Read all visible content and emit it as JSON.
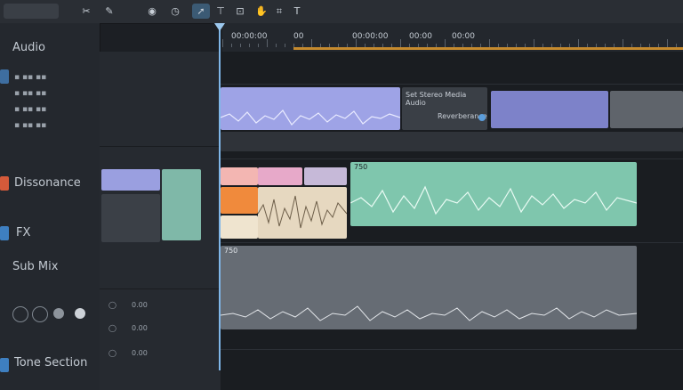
{
  "toolbar": {
    "tools": [
      "select-tool-icon",
      "razor-tool-icon",
      "slip-tool-icon",
      "text-tool-icon",
      "crop-tool-icon",
      "hand-tool-icon"
    ]
  },
  "ruler": {
    "timecodes": [
      "00:00:00",
      "00",
      "00:00:00",
      "00:00",
      "00:00"
    ]
  },
  "left_panel": {
    "labels": [
      "Audio",
      "Dissonance",
      "FX",
      "Sub Mix",
      "Tone Section"
    ]
  },
  "track_headers": {
    "values": [
      "0.00",
      "0.00",
      "0.00"
    ]
  },
  "timeline": {
    "clips": {
      "c1": "Set Stereo Media Audio",
      "c2": "Reverberance",
      "c3": "750",
      "c4": "750"
    }
  },
  "colors": {
    "accent_playhead": "#7fb6e8",
    "clip_purple": "#9a9fe0",
    "clip_teal": "#7fc6ad",
    "clip_orange": "#f08a3c",
    "clip_pink": "#e6a8c6",
    "clip_gray": "#7d838b"
  }
}
